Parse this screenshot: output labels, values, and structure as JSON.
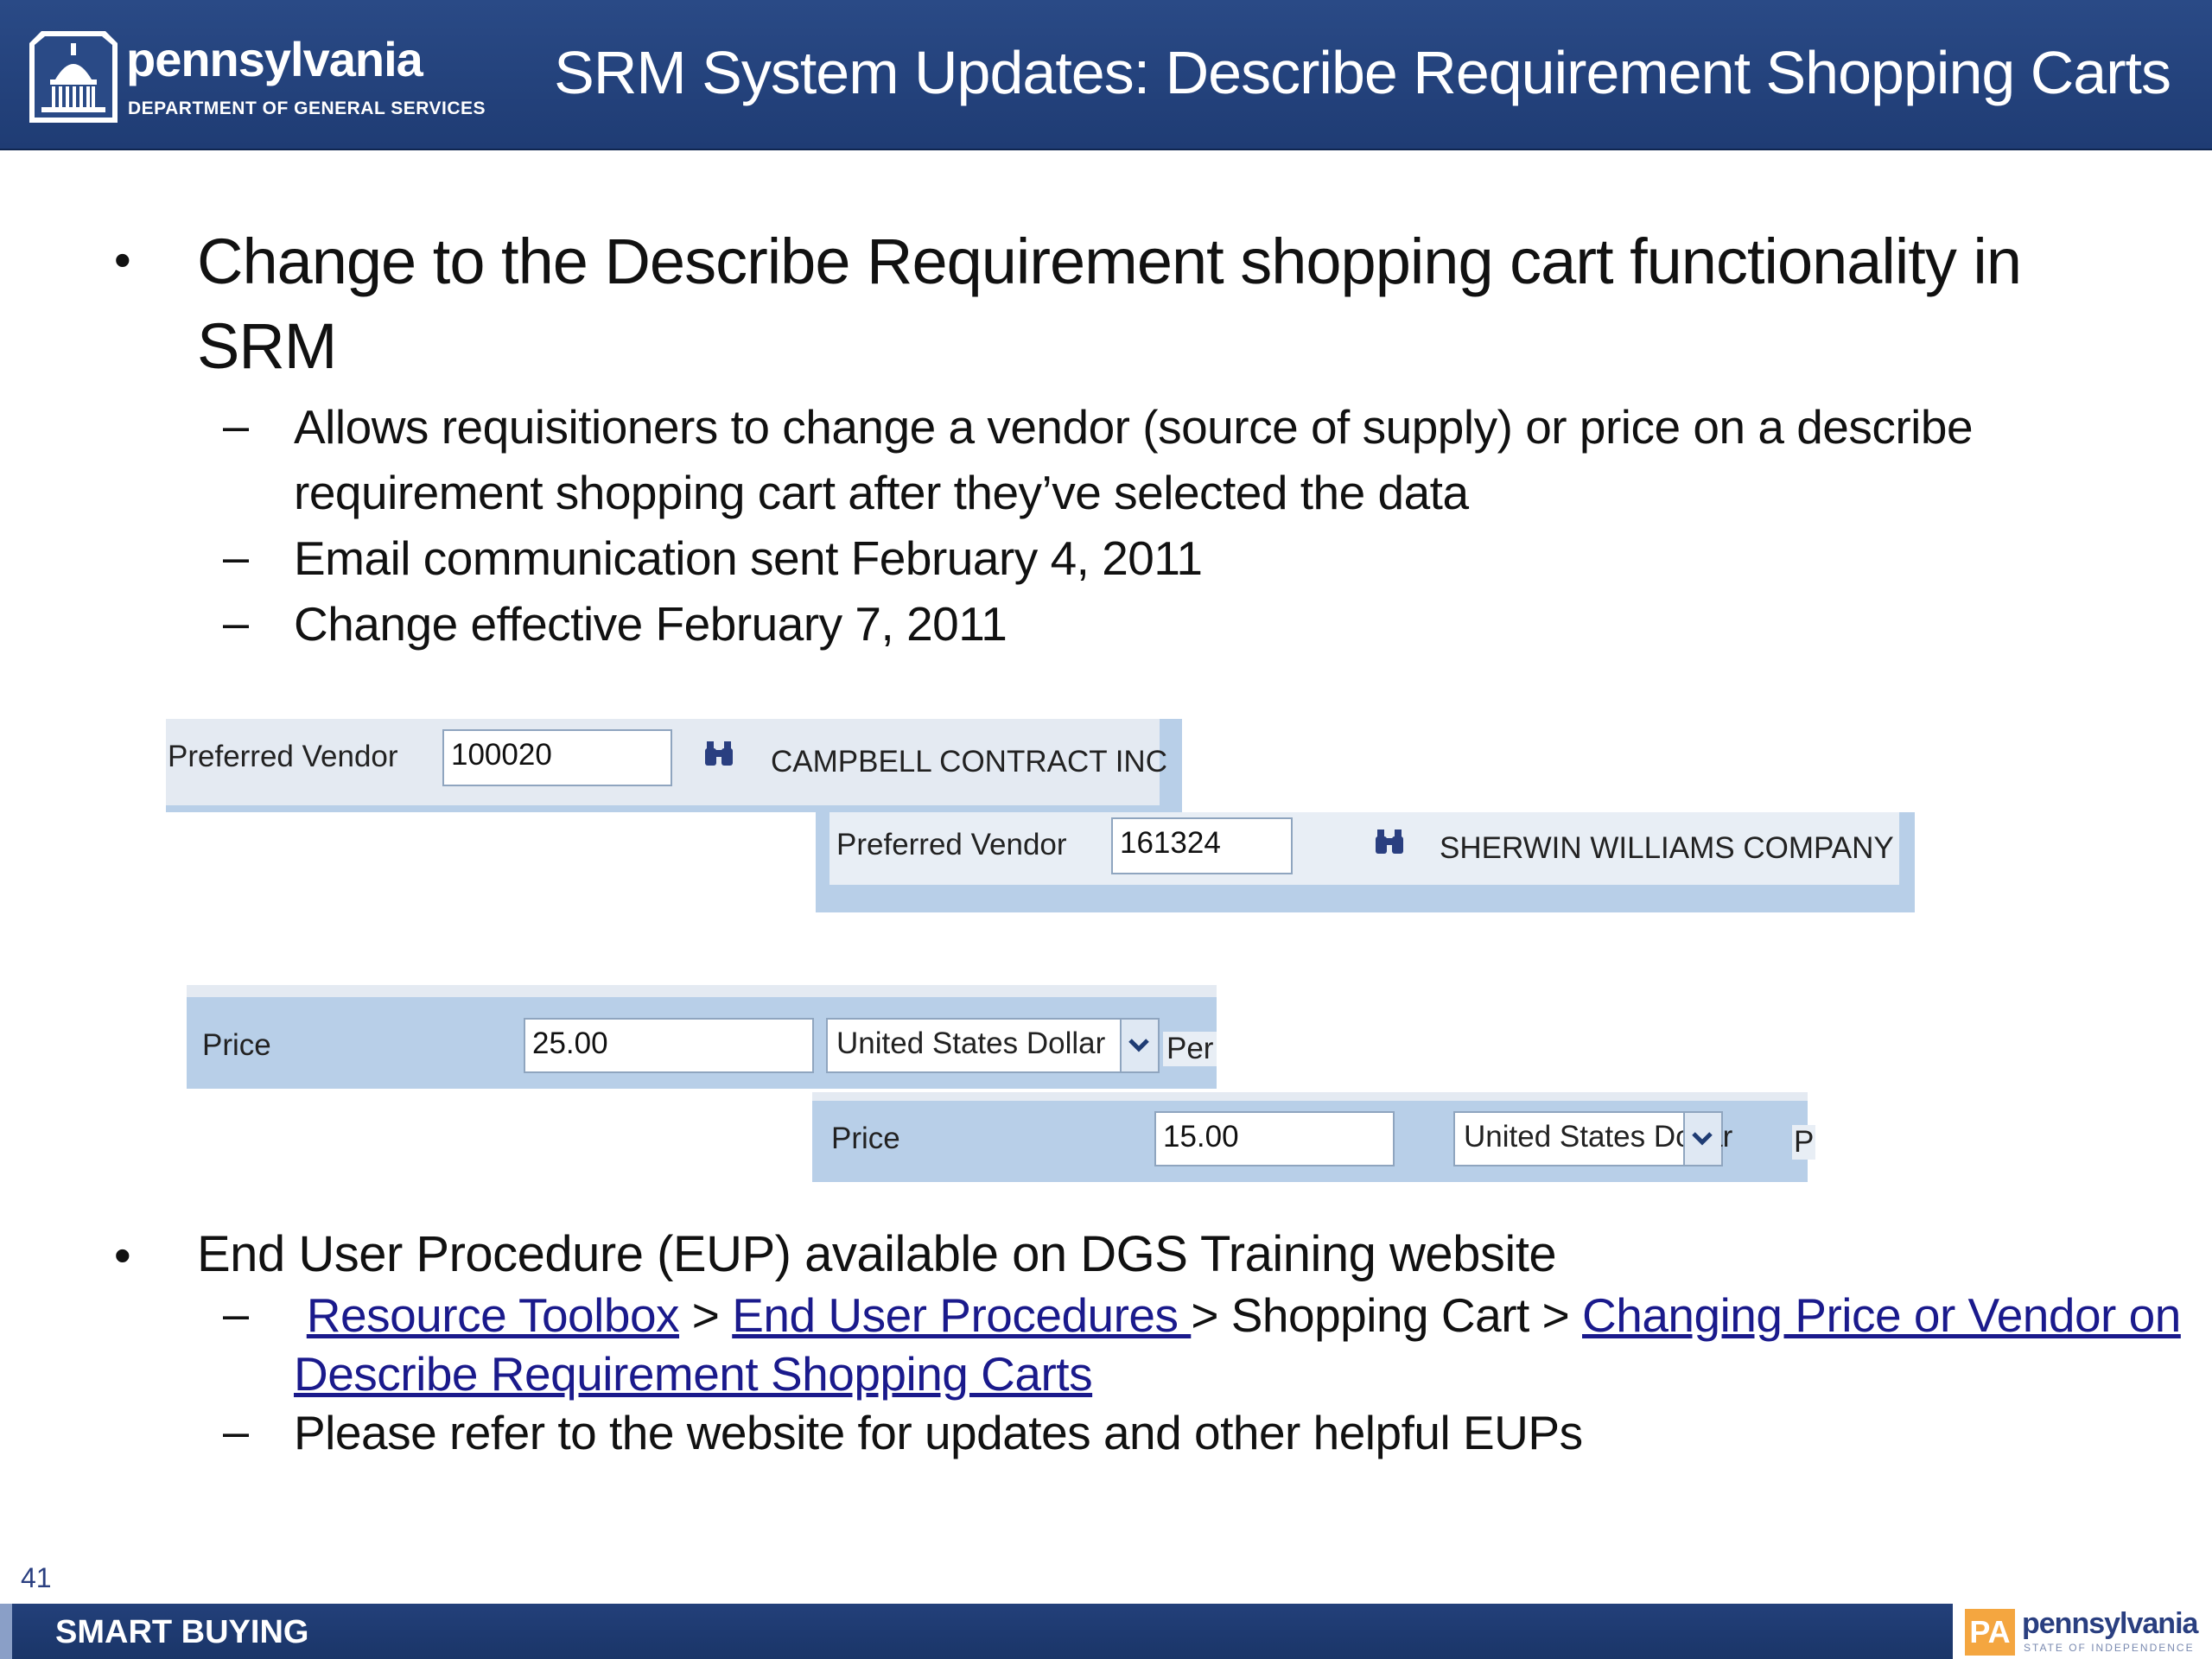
{
  "header": {
    "logo_word": "pennsylvania",
    "logo_sub": "DEPARTMENT OF GENERAL SERVICES",
    "title": "SRM System Updates: Describe Requirement Shopping Carts"
  },
  "bullet1": {
    "marker": "•",
    "line1": "Change to the Describe Requirement shopping cart functionality in",
    "line2": "SRM",
    "subs": [
      {
        "marker": "–",
        "line1": "Allows requisitioners to change a vendor (source of supply) or price on a describe",
        "line2": "requirement shopping cart after they’ve selected the data"
      },
      {
        "marker": "–",
        "line1": "Email communication sent February 4, 2011"
      },
      {
        "marker": "–",
        "line1": "Change effective February 7, 2011"
      }
    ]
  },
  "vendor_before": {
    "label": "Preferred Vendor",
    "value": "100020",
    "name": "CAMPBELL CONTRACT INC"
  },
  "vendor_after": {
    "label": "Preferred Vendor",
    "value": "161324",
    "name": "SHERWIN WILLIAMS COMPANY"
  },
  "price_before": {
    "label": "Price",
    "value": "25.00",
    "currency": "United States Dollar",
    "per": "Per"
  },
  "price_after": {
    "label": "Price",
    "value": "15.00",
    "currency": "United States Dollar",
    "per": "P"
  },
  "bullet2": {
    "marker": "•",
    "text": "End User Procedure (EUP) available on DGS Training website",
    "path": {
      "marker": "–",
      "link1": "Resource Toolbox",
      "sep1": " > ",
      "link2": "End User Procedures ",
      "sep2": " > Shopping Cart > ",
      "link3_line1": "Changing Price or Vendor on",
      "link3_line2": "Describe Requirement Shopping Carts"
    },
    "note": {
      "marker": "–",
      "text": "Please refer to the website for updates and other helpful EUPs"
    }
  },
  "footer": {
    "page_number": "41",
    "text": "SMART BUYING",
    "logo_badge": "PA",
    "logo_word": "pennsylvania",
    "logo_sub": "STATE OF INDEPENDENCE"
  },
  "colors": {
    "header_bg": "#1f3c74",
    "panel_bg": "#b8cfe8",
    "link": "#1a1a8c"
  }
}
